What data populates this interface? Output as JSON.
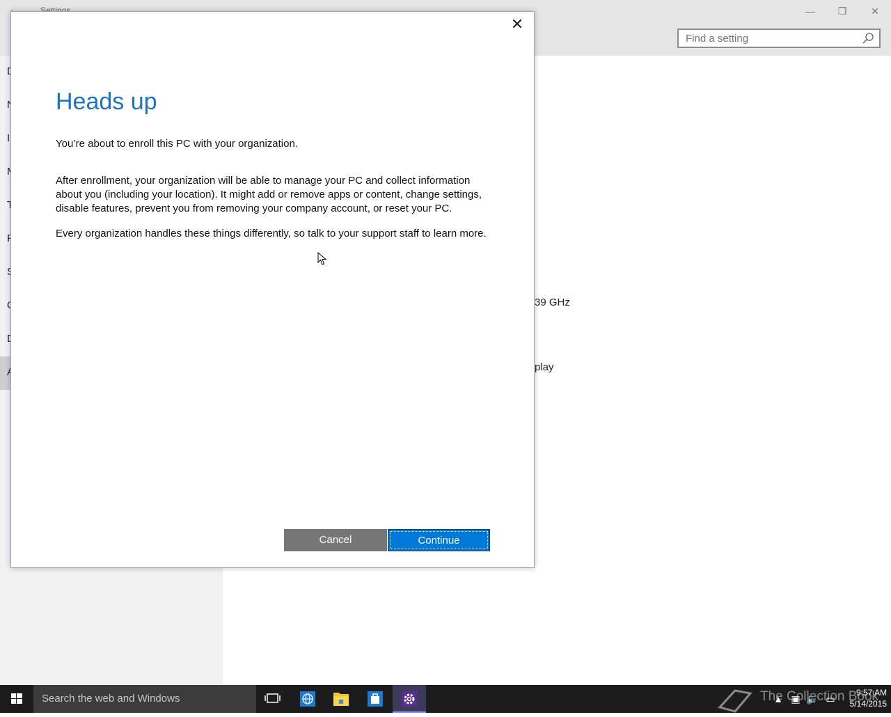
{
  "window": {
    "title": "Settings",
    "back_glyph": "←",
    "minimize_glyph": "—",
    "maximize_glyph": "❐",
    "close_glyph": "✕",
    "search_placeholder": "Find a setting"
  },
  "sidebar": {
    "items": [
      {
        "label": "D"
      },
      {
        "label": "N"
      },
      {
        "label": "I"
      },
      {
        "label": "M"
      },
      {
        "label": "T"
      },
      {
        "label": "P"
      },
      {
        "label": "S"
      },
      {
        "label": "O"
      },
      {
        "label": "D"
      },
      {
        "label": "A"
      }
    ]
  },
  "main": {
    "processor_fragment": "39 GHz",
    "display_fragment": "play"
  },
  "dialog": {
    "close_glyph": "✕",
    "title": "Heads up",
    "intro": "You’re about to enroll this PC with your organization.",
    "body": "After enrollment, your organization will be able to manage your PC and collect information about you (including your location). It might add or remove apps or content, change settings, disable features, prevent you from removing your company account, or reset your PC.",
    "body2": "Every organization handles these things differently, so talk to your support staff to learn more.",
    "cancel_label": "Cancel",
    "continue_label": "Continue"
  },
  "taskbar": {
    "search_text": "Search the web and Windows",
    "watermark": "The Collection Book",
    "time": "9:57 AM",
    "date": "5/14/2015"
  },
  "colors": {
    "accent": "#0078d7",
    "title_blue": "#1f73bf"
  }
}
